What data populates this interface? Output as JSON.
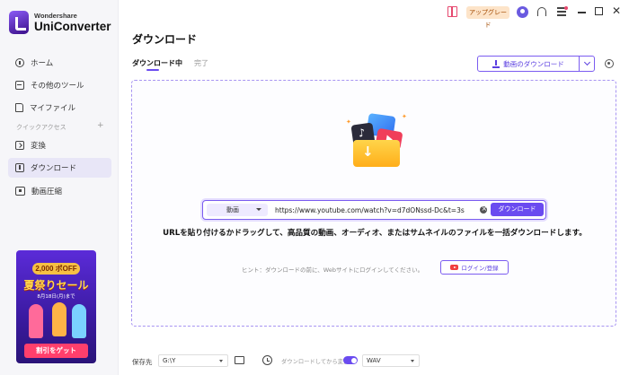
{
  "app": {
    "brand": "Wondershare",
    "product": "UniConverter"
  },
  "titlebar": {
    "upgrade_label": "アップグレード"
  },
  "sidebar": {
    "items": [
      {
        "label": "ホーム",
        "icon": "home-icon"
      },
      {
        "label": "その他のツール",
        "icon": "toolbox-icon"
      },
      {
        "label": "マイファイル",
        "icon": "file-icon"
      }
    ],
    "section_label": "クイックアクセス",
    "section_add": "+",
    "quick_items": [
      {
        "label": "変換",
        "icon": "convert-icon"
      },
      {
        "label": "ダウンロード",
        "icon": "download-icon",
        "active": true
      },
      {
        "label": "動画圧縮",
        "icon": "compress-icon"
      }
    ]
  },
  "promo": {
    "badge": "2,000 ポOFF",
    "title": "夏祭りセール",
    "date": "8月18日(月)まで",
    "button": "割引をゲット"
  },
  "main": {
    "title": "ダウンロード",
    "tabs": [
      {
        "label": "ダウンロード中",
        "active": true
      },
      {
        "label": "完了",
        "active": false
      }
    ],
    "download_video_button": "動画のダウンロード",
    "url_bar": {
      "type_value": "動画",
      "url_value": "https://www.youtube.com/watch?v=d7dONssd-Dc&t=3s",
      "download_button": "ダウンロード"
    },
    "hint_main": "URLを貼り付けるかドラッグして、高品質の動画、オーディオ、またはサムネイルのファイルを一括ダウンロードします。",
    "hint_sub": "ヒント：ダウンロードの前に、Webサイトにログインしてください。",
    "login_button": "ログイン/登録"
  },
  "bottombar": {
    "save_label": "保存先",
    "save_value": "G:\\Y",
    "convert_label": "ダウンロードしてから変換",
    "convert_enabled": true,
    "format_value": "WAV"
  },
  "colors": {
    "accent": "#6a4bf0",
    "active_nav_bg": "#e8e6f7",
    "upgrade_bg": "#fde4c9"
  }
}
